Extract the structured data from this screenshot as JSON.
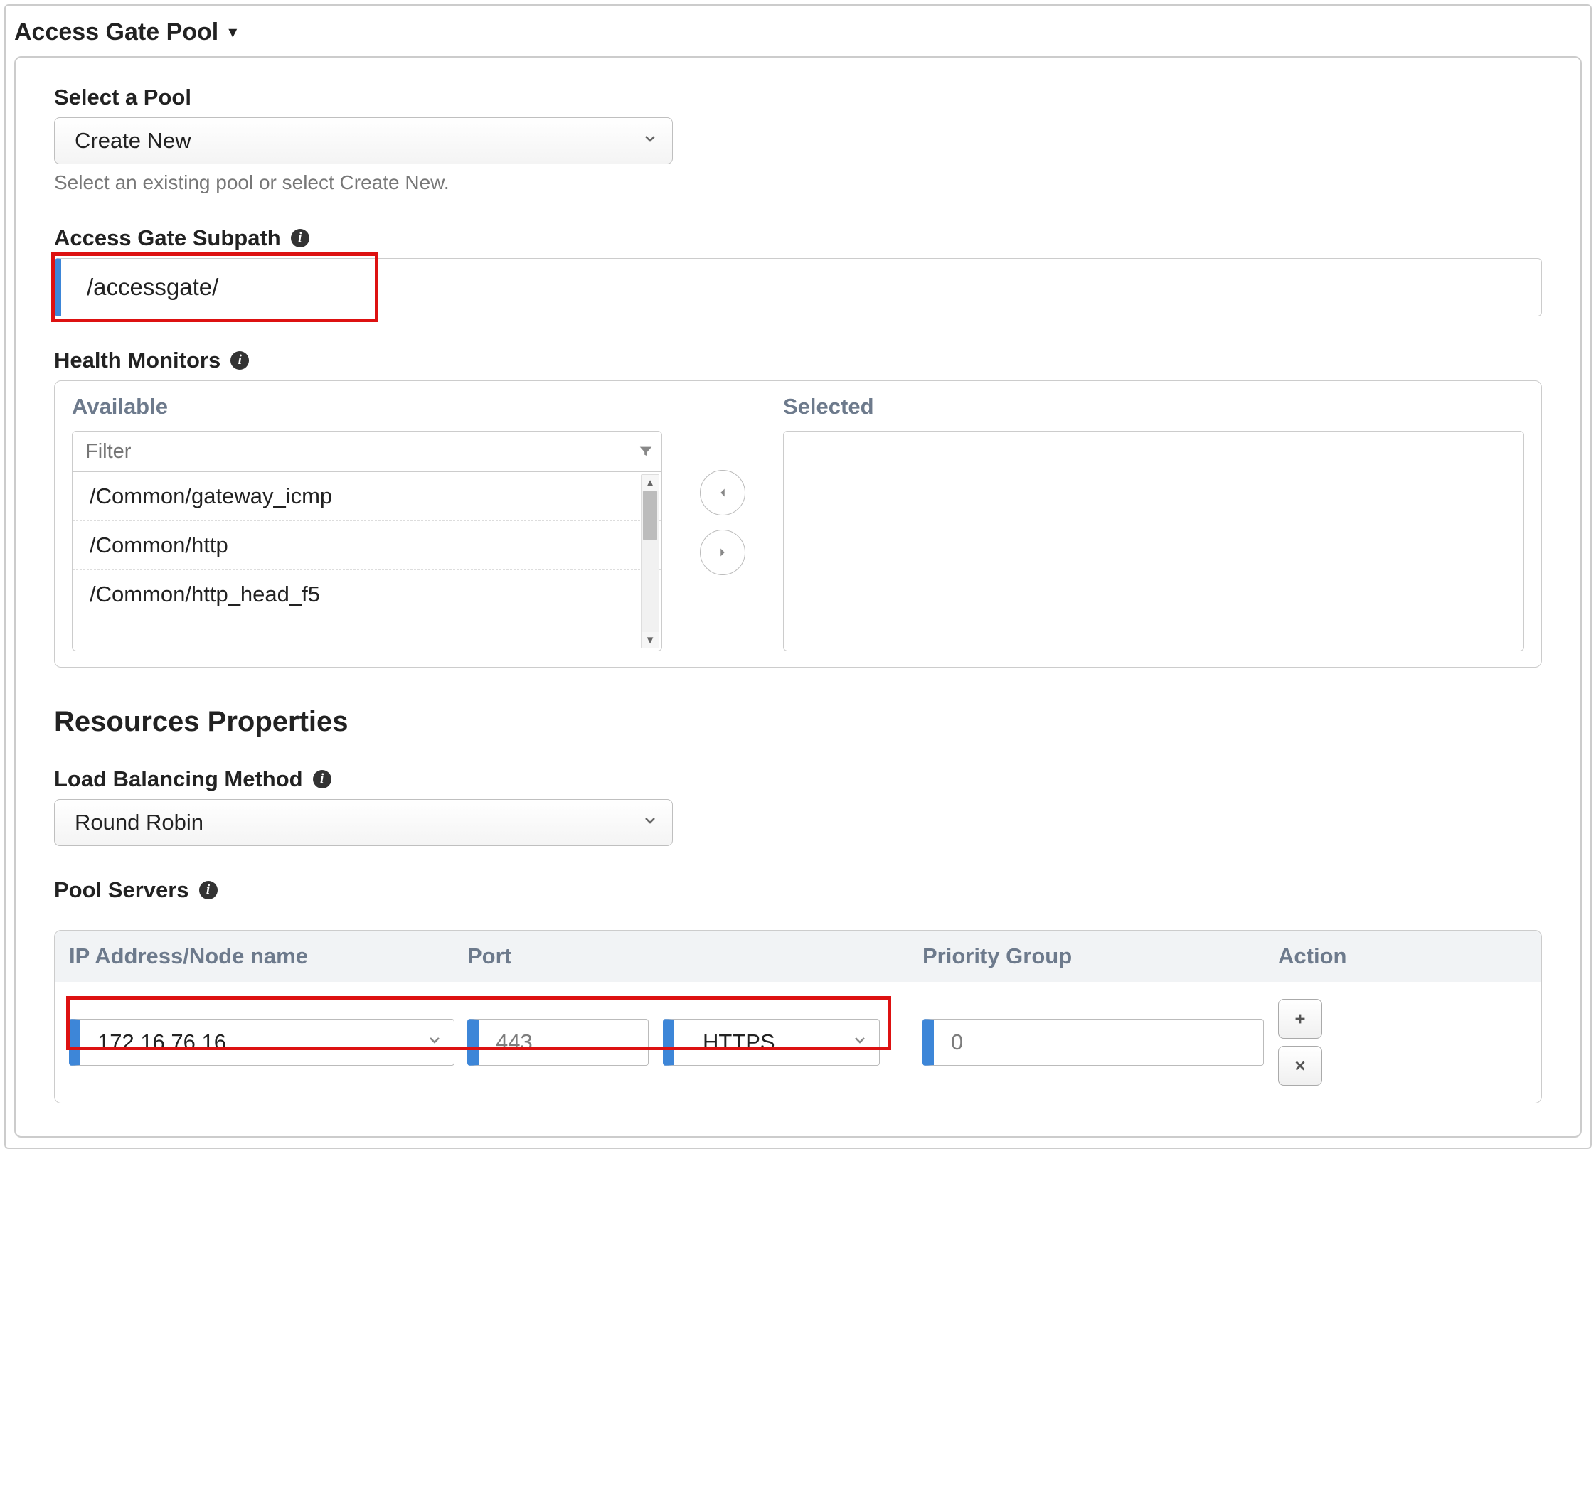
{
  "section": {
    "title": "Access Gate Pool"
  },
  "pool_select": {
    "label": "Select a Pool",
    "value": "Create New",
    "helper": "Select an existing pool or select Create New."
  },
  "subpath": {
    "label": "Access Gate Subpath",
    "value": "/accessgate/"
  },
  "health_monitors": {
    "label": "Health Monitors",
    "available_label": "Available",
    "selected_label": "Selected",
    "filter_placeholder": "Filter",
    "items": [
      "/Common/gateway_icmp",
      "/Common/http",
      "/Common/http_head_f5"
    ]
  },
  "resources": {
    "heading": "Resources Properties",
    "lb_label": "Load Balancing Method",
    "lb_value": "Round Robin"
  },
  "pool_servers": {
    "label": "Pool Servers",
    "columns": {
      "ip": "IP Address/Node name",
      "port": "Port",
      "pg": "Priority Group",
      "action": "Action"
    },
    "row": {
      "ip": "172.16.76.16",
      "port": "443",
      "proto": "HTTPS",
      "pg": "0"
    }
  }
}
